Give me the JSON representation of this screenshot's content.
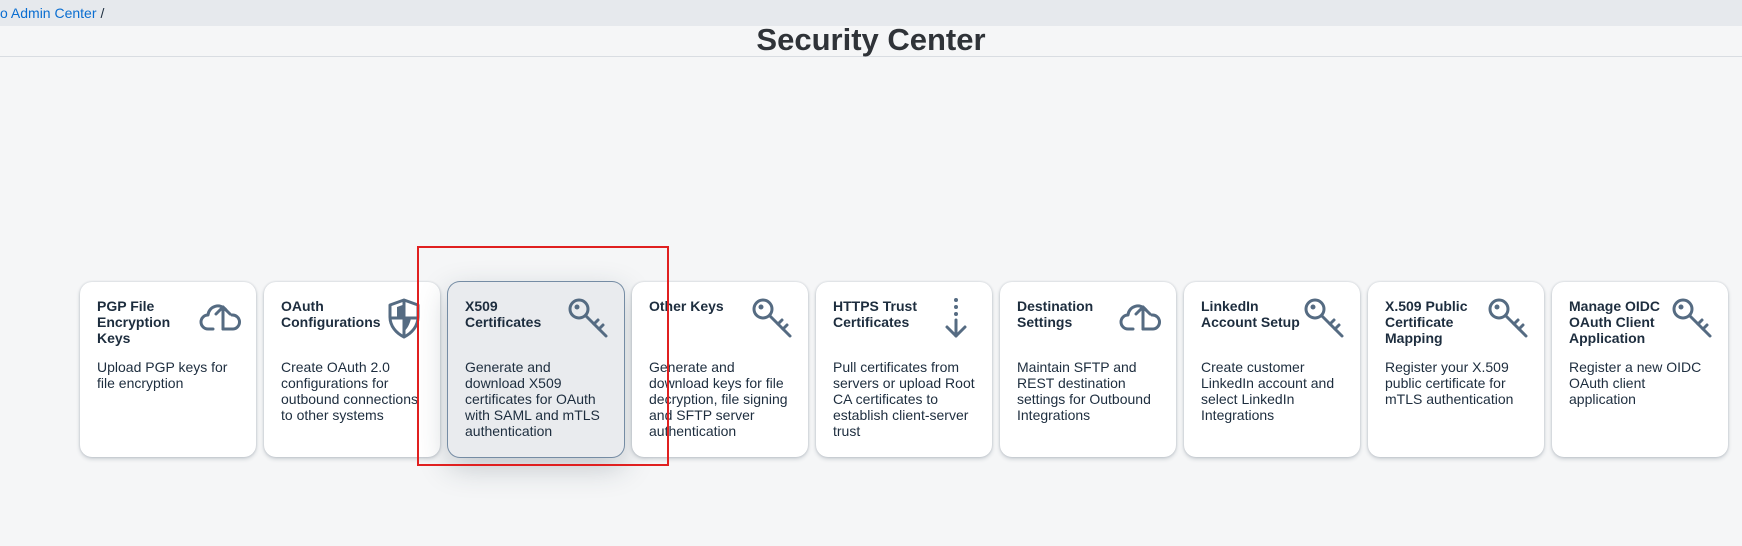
{
  "breadcrumb": {
    "link_label": "o Admin Center",
    "separator": "/"
  },
  "page": {
    "title": "Security Center"
  },
  "colors": {
    "icon": "#556b82",
    "link": "#0a6ed1",
    "highlight": "#e02020"
  },
  "tiles": [
    {
      "title": "PGP File Encryption Keys",
      "description": "Upload PGP keys for file encryption",
      "icon": "cloud-upload-icon"
    },
    {
      "title": "OAuth Configurations",
      "description": "Create OAuth 2.0 configurations for outbound connections to other systems",
      "icon": "shield-icon"
    },
    {
      "title": "X509 Certificates",
      "description": "Generate and download X509 certificates for OAuth with SAML and mTLS authentication",
      "icon": "key-icon"
    },
    {
      "title": "Other Keys",
      "description": "Generate and download keys for file decryption, file signing and SFTP server authentication",
      "icon": "key-icon"
    },
    {
      "title": "HTTPS Trust Certificates",
      "description": "Pull certificates from servers or upload Root CA certificates to establish client-server trust",
      "icon": "download-arrow-icon"
    },
    {
      "title": "Destination Settings",
      "description": "Maintain SFTP and REST destination settings for Outbound Integrations",
      "icon": "cloud-upload-icon"
    },
    {
      "title": "LinkedIn Account Setup",
      "description": "Create customer LinkedIn account and select LinkedIn Integrations",
      "icon": "key-icon"
    },
    {
      "title": "X.509 Public Certificate Mapping",
      "description": "Register your X.509 public certificate for mTLS authentication",
      "icon": "key-icon"
    },
    {
      "title": "Manage OIDC OAuth Client Application",
      "description": "Register a new OIDC OAuth client application",
      "icon": "key-icon"
    }
  ]
}
